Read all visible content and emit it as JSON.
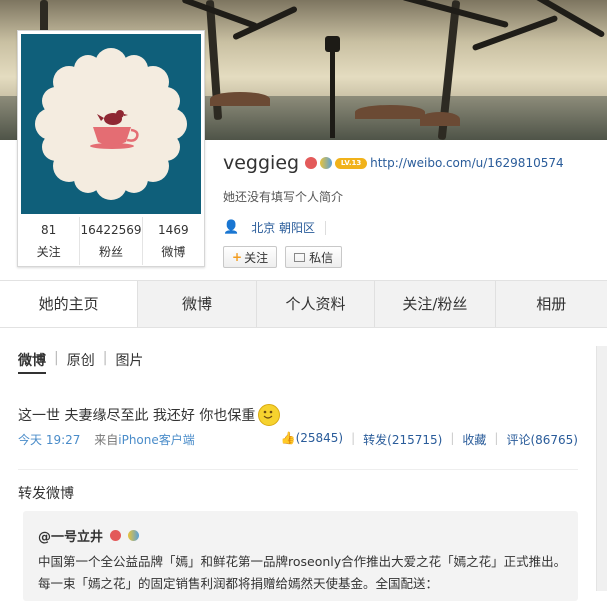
{
  "profile": {
    "name": "veggieg",
    "level": "LV.13",
    "url": "http://weibo.com/u/1629810574",
    "bio": "她还没有填写个人简介",
    "location": "北京 朝阳区",
    "follow_label": "关注",
    "message_label": "私信"
  },
  "stats": [
    {
      "num": "81",
      "label": "关注"
    },
    {
      "num": "16422569",
      "label": "粉丝"
    },
    {
      "num": "1469",
      "label": "微博"
    }
  ],
  "tabs": [
    {
      "label": "她的主页"
    },
    {
      "label": "微博"
    },
    {
      "label": "个人资料"
    },
    {
      "label": "关注/粉丝"
    },
    {
      "label": "相册"
    }
  ],
  "filters": {
    "weibo": "微博",
    "original": "原创",
    "pictures": "图片"
  },
  "post": {
    "text": "这一世 夫妻缘尽至此 我还好 你也保重",
    "time": "今天 19:27",
    "source_prefix": "来自",
    "source": "iPhone客户端",
    "likes": "(25845)",
    "repost": "转发(215715)",
    "favorite": "收藏",
    "comment": "评论(86765)"
  },
  "repost_section_title": "转发微博",
  "quoted": {
    "author": "@一号立井",
    "body": "中国第一个全公益品牌「嫣」和鲜花第一品牌roseonly合作推出大爱之花「嫣之花」正式推出。每一束「嫣之花」的固定销售利润都将捐赠给嫣然天使基金。全国配送："
  },
  "colors": {
    "link": "#2a5c9a",
    "avatar_bg": "#0f5f7a",
    "teacup": "#e46d73"
  }
}
